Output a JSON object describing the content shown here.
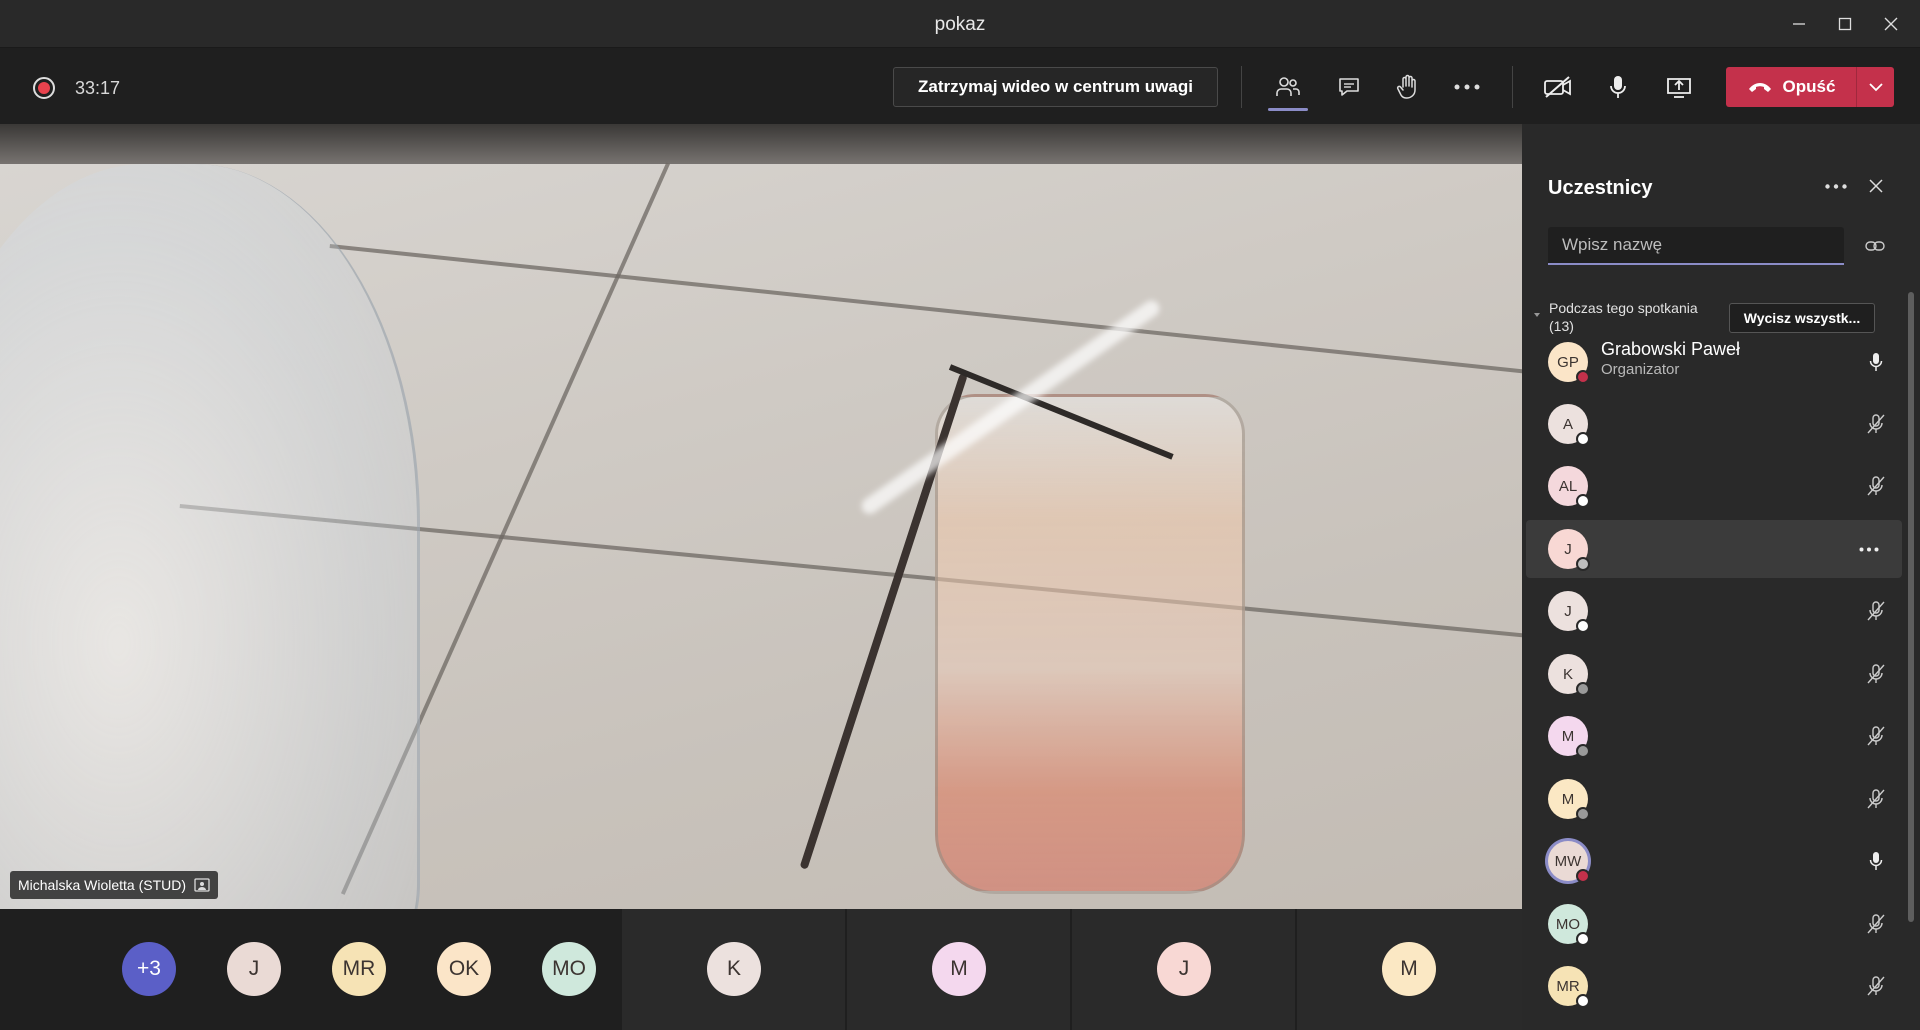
{
  "window": {
    "title": "pokaz"
  },
  "toolbar": {
    "timer": "33:17",
    "spotlight_label": "Zatrzymaj wideo w centrum uwagi",
    "leave_label": "Opuść"
  },
  "video": {
    "participant_name": "Michalska Wioletta (STUD)"
  },
  "strip": {
    "avatars": [
      {
        "initials": "+3",
        "color": "#5b5fc7",
        "text_color": "#ffffff"
      },
      {
        "initials": "J",
        "color": "#eadad5"
      },
      {
        "initials": "MR",
        "color": "#f6e3b5"
      },
      {
        "initials": "OK",
        "color": "#fbe5c8"
      },
      {
        "initials": "MO",
        "color": "#cfe8dc"
      }
    ],
    "tiles": [
      {
        "initials": "K",
        "color": "#ece1de"
      },
      {
        "initials": "M",
        "color": "#f4d8ee"
      },
      {
        "initials": "J",
        "color": "#f8d8d4"
      },
      {
        "initials": "M",
        "color": "#fbe8c4"
      }
    ]
  },
  "panel": {
    "title": "Uczestnicy",
    "search_placeholder": "Wpisz nazwę",
    "section_label": "Podczas tego spotkania (13)",
    "mute_all_label": "Wycisz wszystk...",
    "participants": [
      {
        "initials": "GP",
        "name": "Grabowski Paweł",
        "role": "Organizator",
        "color": "#fbe5c8",
        "status": "busy",
        "mic": "on"
      },
      {
        "initials": "A",
        "name": "",
        "role": "",
        "color": "#ece1de",
        "status": "available",
        "mic": "off"
      },
      {
        "initials": "AL",
        "name": "",
        "role": "",
        "color": "#f4d8dc",
        "status": "available",
        "mic": "off"
      },
      {
        "initials": "J",
        "name": "",
        "role": "",
        "color": "#f8d8d4",
        "status": "away",
        "mic": "more"
      },
      {
        "initials": "J",
        "name": "",
        "role": "",
        "color": "#ece1de",
        "status": "available",
        "mic": "off"
      },
      {
        "initials": "K",
        "name": "",
        "role": "",
        "color": "#ece1de",
        "status": "offline",
        "mic": "off"
      },
      {
        "initials": "M",
        "name": "",
        "role": "",
        "color": "#f4d8ee",
        "status": "offline",
        "mic": "off"
      },
      {
        "initials": "M",
        "name": "",
        "role": "",
        "color": "#fbe8c4",
        "status": "offline",
        "mic": "off"
      },
      {
        "initials": "MW",
        "name": "",
        "role": "",
        "color": "#eadad5",
        "status": "busy",
        "mic": "on",
        "ring": true
      },
      {
        "initials": "MO",
        "name": "",
        "role": "",
        "color": "#cfe8dc",
        "status": "available",
        "mic": "off"
      },
      {
        "initials": "MR",
        "name": "",
        "role": "",
        "color": "#f6e3b5",
        "status": "available",
        "mic": "off"
      }
    ]
  },
  "colors": {
    "accent": "#8b8cc7",
    "leave": "#c4314b",
    "record": "#e8424d"
  },
  "icons": [
    "record-icon",
    "participants-icon",
    "chat-icon",
    "raise-hand-icon",
    "more-icon",
    "camera-off-icon",
    "microphone-icon",
    "share-screen-icon",
    "hang-up-icon",
    "chevron-down-icon",
    "close-icon",
    "link-icon",
    "pin-icon",
    "mic-muted-icon"
  ]
}
